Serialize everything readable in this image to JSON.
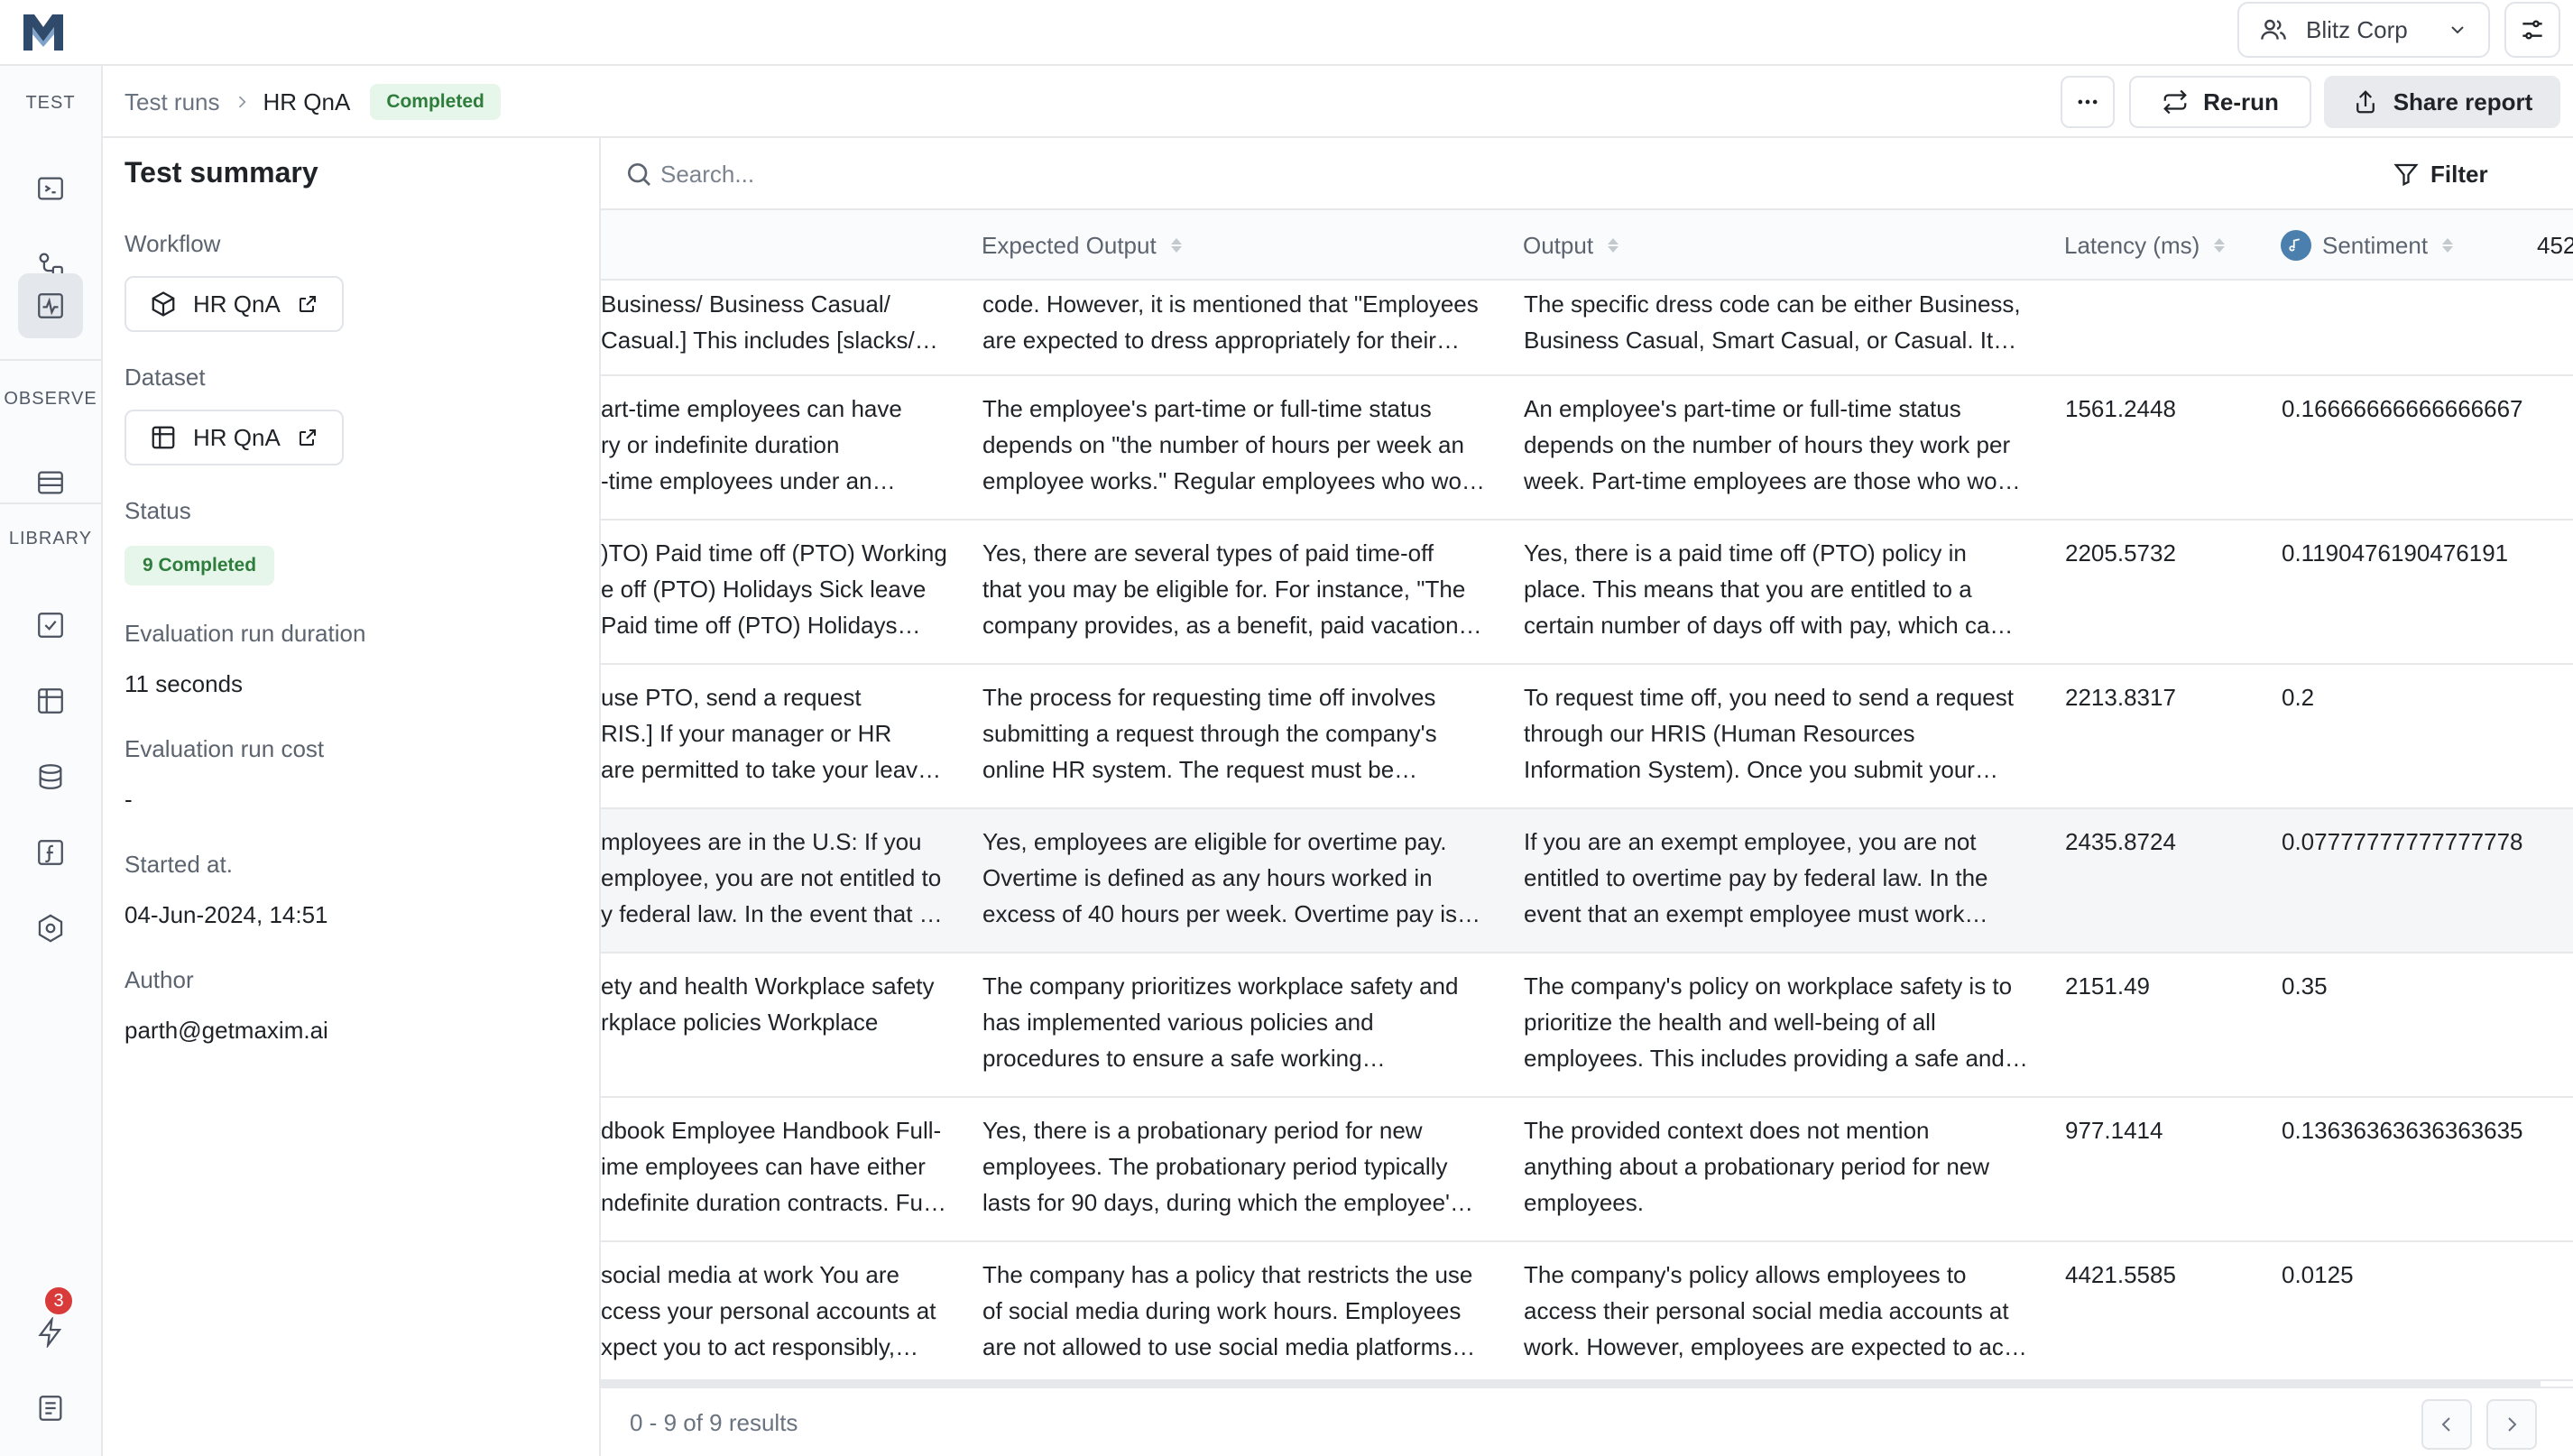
{
  "org": {
    "name": "Blitz Corp"
  },
  "nav": {
    "sections": [
      "TEST",
      "OBSERVE",
      "LIBRARY"
    ],
    "notification_count": "3"
  },
  "breadcrumb": {
    "parent": "Test runs",
    "current": "HR QnA",
    "status": "Completed"
  },
  "actions": {
    "more": "More",
    "rerun": "Re-run",
    "share": "Share report"
  },
  "summary": {
    "title": "Test summary",
    "workflow_label": "Workflow",
    "workflow_value": "HR QnA",
    "dataset_label": "Dataset",
    "dataset_value": "HR QnA",
    "status_label": "Status",
    "status_value": "9 Completed",
    "duration_label": "Evaluation run duration",
    "duration_value": "11 seconds",
    "cost_label": "Evaluation run cost",
    "cost_value": "-",
    "started_label": "Started at.",
    "started_value": "04-Jun-2024, 14:51",
    "author_label": "Author",
    "author_value": "parth@getmaxim.ai"
  },
  "table": {
    "search_placeholder": "Search...",
    "filter_label": "Filter",
    "columns": [
      "Expected Output",
      "Output",
      "Latency (ms)",
      "Sentiment"
    ],
    "overflow_header": "452",
    "rows": [
      {
        "context": [
          "Business/ Business Casual/",
          "Casual.] This includes [slacks/…"
        ],
        "expected": [
          "code. However, it is mentioned that \"Employees",
          "are expected to dress appropriately for their…"
        ],
        "output": [
          "The specific dress code can be either Business,",
          "Business Casual, Smart Casual, or Casual. It…"
        ],
        "latency": "",
        "sentiment": ""
      },
      {
        "context": [
          "art-time employees can have",
          "ry or indefinite duration",
          "-time employees under an…"
        ],
        "expected": [
          "The employee's part-time or full-time status",
          "depends on \"the number of hours per week an",
          "employee works.\" Regular employees who wo…"
        ],
        "output": [
          "An employee's part-time or full-time status",
          "depends on the number of hours they work per",
          "week. Part-time employees are those who wo…"
        ],
        "latency": "1561.2448",
        "sentiment": "0.16666666666666667"
      },
      {
        "context": [
          ")TO) Paid time off (PTO) Working",
          "e off (PTO) Holidays Sick leave",
          " Paid time off (PTO) Holidays…"
        ],
        "expected": [
          "Yes, there are several types of paid time-off",
          "that you may be eligible for. For instance, \"The",
          "company provides, as a benefit, paid vacation…"
        ],
        "output": [
          "Yes, there is a paid time off (PTO) policy in",
          "place. This means that you are entitled to a",
          "certain number of days off with pay, which ca…"
        ],
        "latency": "2205.5732",
        "sentiment": "0.1190476190476191"
      },
      {
        "context": [
          "use PTO, send a request",
          "RIS.] If your manager or HR",
          "are permitted to take your leav…"
        ],
        "expected": [
          "The process for requesting time off involves",
          "submitting a request through the company's",
          "online HR system. The request must be…"
        ],
        "output": [
          "To request time off, you need to send a request",
          "through our HRIS (Human Resources",
          "Information System). Once you submit your…"
        ],
        "latency": "2213.8317",
        "sentiment": "0.2"
      },
      {
        "context": [
          "mployees are in the U.S: If you",
          "employee, you are not entitled to",
          "y federal law. In the event that …"
        ],
        "expected": [
          "Yes, employees are eligible for overtime pay.",
          "Overtime is defined as any hours worked in",
          "excess of 40 hours per week. Overtime pay is…"
        ],
        "output": [
          "If you are an exempt employee, you are not",
          "entitled to overtime pay by federal law. In the",
          "event that an exempt employee must work…"
        ],
        "latency": "2435.8724",
        "sentiment": "0.07777777777777778"
      },
      {
        "context": [
          "ety and health Workplace safety",
          "rkplace policies Workplace"
        ],
        "expected": [
          "The company prioritizes workplace safety and",
          "has implemented various policies and",
          "procedures to ensure a safe working…"
        ],
        "output": [
          "The company's policy on workplace safety is to",
          "prioritize the health and well-being of all",
          "employees. This includes providing a safe and…"
        ],
        "latency": "2151.49",
        "sentiment": "0.35"
      },
      {
        "context": [
          "dbook Employee Handbook Full-",
          "ime employees can have either",
          "ndefinite duration contracts. Fu…"
        ],
        "expected": [
          "Yes, there is a probationary period for new",
          "employees. The probationary period typically",
          "lasts for 90 days, during which the employee'…"
        ],
        "output": [
          "The provided context does not mention",
          "anything about a probationary period for new",
          "employees."
        ],
        "latency": "977.1414",
        "sentiment": "0.13636363636363635"
      },
      {
        "context": [
          " social media at work You are",
          "ccess your personal accounts at",
          "xpect you to act responsibly,…"
        ],
        "expected": [
          "The company has a policy that restricts the use",
          "of social media during work hours. Employees",
          "are not allowed to use social media platforms…"
        ],
        "output": [
          "The company's policy allows employees to",
          "access their personal social media accounts at",
          "work. However, employees are expected to ac…"
        ],
        "latency": "4421.5585",
        "sentiment": "0.0125"
      }
    ],
    "results_text": "0 - 9 of 9 results"
  },
  "colors": {
    "accent_green": "#2e7d3c",
    "green_bg": "#e7f6ea",
    "badge_red": "#d93a3a",
    "sentiment_dot": "#4b7fae"
  }
}
